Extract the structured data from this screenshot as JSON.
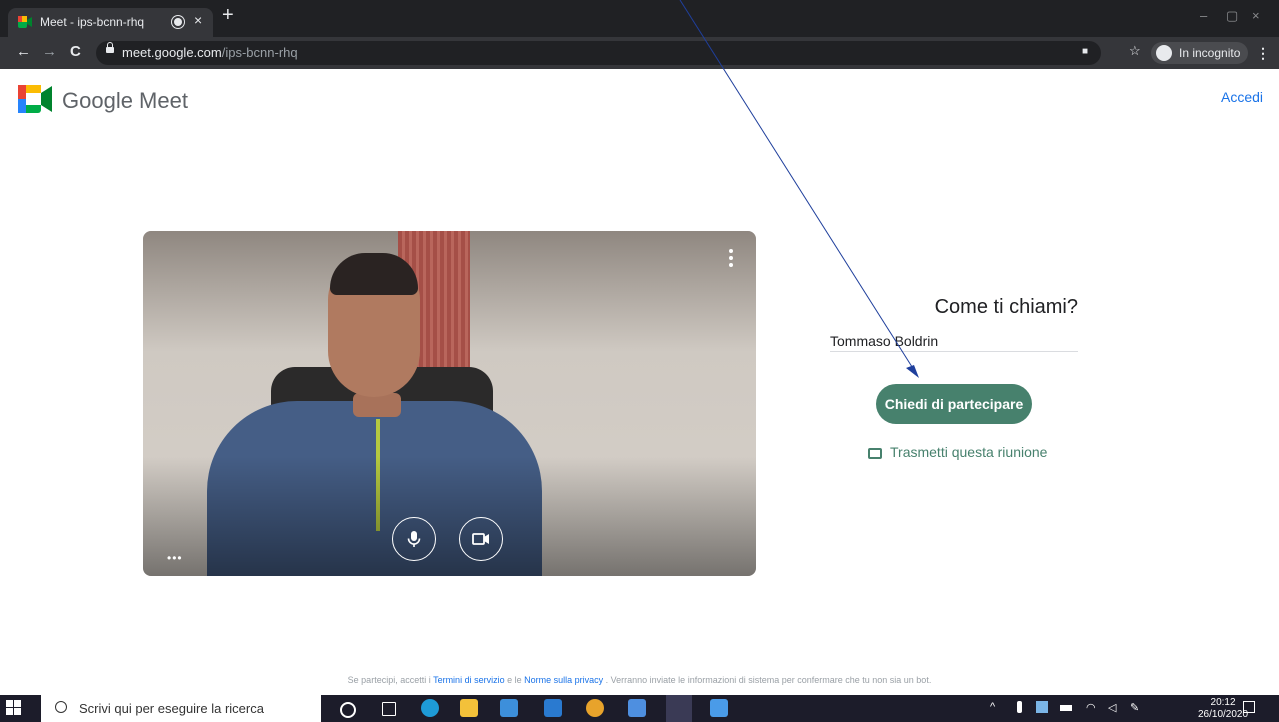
{
  "browser": {
    "tab_title": "Meet - ips-bcnn-rhq",
    "close_tab": "×",
    "new_tab": "+",
    "url_host": "meet.google.com",
    "url_path": "/ips-bcnn-rhq",
    "incognito_label": "In incognito",
    "back": "←",
    "forward": "→",
    "reload": "C",
    "star": "☆",
    "menu": "⋮",
    "minimize": "–",
    "maximize": "▢",
    "close_window": "×"
  },
  "header": {
    "brand": "Google Meet",
    "sign_in": "Accedi"
  },
  "video": {
    "more_options_dots": "•••"
  },
  "join": {
    "prompt": "Come ti chiami?",
    "name_value": "Tommaso Boldrin",
    "join_button": "Chiedi di partecipare",
    "cast_label": "Trasmetti questa riunione"
  },
  "footer": {
    "prefix": "Se partecipi, accetti i ",
    "terms": "Termini di servizio",
    "and": " e le ",
    "privacy": "Norme sulla privacy",
    "suffix": " . Verranno inviate le informazioni di sistema per confermare che tu non sia un bot."
  },
  "taskbar": {
    "search_placeholder": "Scrivi qui per eseguire la ricerca",
    "time": "20:12",
    "date": "26/10/2020"
  },
  "colors": {
    "accent_green": "#47816d",
    "link_blue": "#1a73e8",
    "annotation_line": "#1f3f9c"
  }
}
